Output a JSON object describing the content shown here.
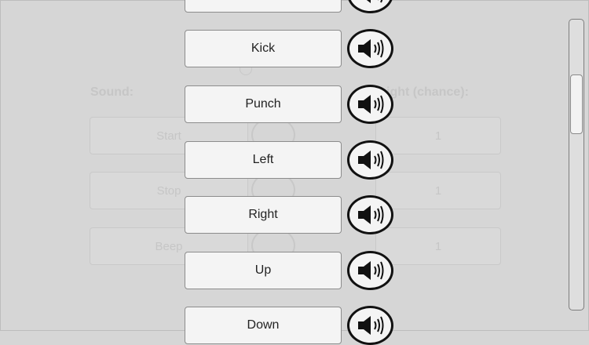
{
  "background": {
    "sound_label": "Sound:",
    "weight_label": "ight (chance):",
    "rows": [
      {
        "name": "Start",
        "weight": "1"
      },
      {
        "name": "Stop",
        "weight": "1"
      },
      {
        "name": "Beep",
        "weight": "1"
      }
    ]
  },
  "sounds": [
    {
      "label": "",
      "icon": "speaker-icon"
    },
    {
      "label": "Kick",
      "icon": "speaker-icon"
    },
    {
      "label": "Punch",
      "icon": "speaker-icon"
    },
    {
      "label": "Left",
      "icon": "speaker-icon"
    },
    {
      "label": "Right",
      "icon": "speaker-icon"
    },
    {
      "label": "Up",
      "icon": "speaker-icon"
    },
    {
      "label": "Down",
      "icon": "speaker-icon"
    }
  ],
  "colors": {
    "background": "#d6d6d6",
    "button": "#f4f4f4",
    "icon": "#111111"
  }
}
